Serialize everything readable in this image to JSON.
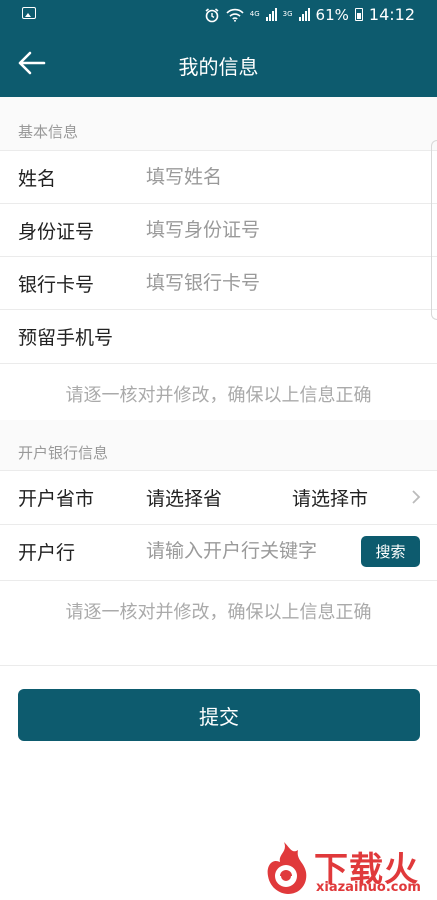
{
  "status_bar": {
    "battery": "61%",
    "time": "14:12",
    "network_1": "4G",
    "network_2": "3G",
    "icons": [
      "image-icon",
      "alarm-icon",
      "wifi-icon",
      "signal-icon",
      "battery-icon"
    ]
  },
  "nav": {
    "title": "我的信息",
    "back_icon": "arrow-left-icon"
  },
  "basic_section": {
    "label": "基本信息",
    "fields": [
      {
        "label": "姓名",
        "value": "",
        "placeholder": "填写姓名"
      },
      {
        "label": "身份证号",
        "value": "",
        "placeholder": "填写身份证号"
      },
      {
        "label": "银行卡号",
        "value": "",
        "placeholder": "填写银行卡号"
      },
      {
        "label": "预留手机号",
        "value": "",
        "placeholder": ""
      }
    ],
    "hint": "请逐一核对并修改，确保以上信息正确"
  },
  "bank_section": {
    "label": "开户银行信息",
    "province_row": {
      "label": "开户省市",
      "province": "请选择省",
      "city": "请选择市",
      "chevron_icon": "chevron-right-icon"
    },
    "branch_row": {
      "label": "开户行",
      "value": "",
      "placeholder": "请输入开户行关键字",
      "search_label": "搜索"
    },
    "hint": "请逐一核对并修改，确保以上信息正确"
  },
  "submit_label": "提交",
  "watermark": {
    "brand": "下载火",
    "domain": "xiazaihuo.com"
  },
  "colors": {
    "primary": "#0d5b6e",
    "hint_text": "#aaaaaa",
    "watermark": "#e0393b"
  }
}
